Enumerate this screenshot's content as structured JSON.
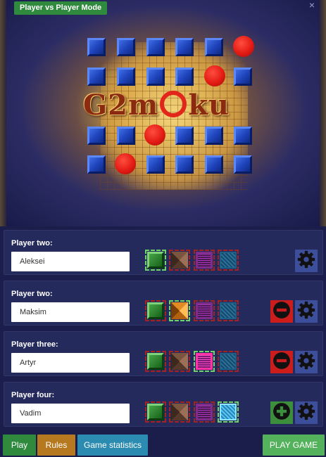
{
  "mode_badge": "Player vs Player Mode",
  "close_symbol": "×",
  "logo": {
    "part1": "G",
    "part2": "2m",
    "part3": "ku"
  },
  "players": [
    {
      "label": "Player two:",
      "name": "Aleksei",
      "selected_tile": "green",
      "action": "none"
    },
    {
      "label": "Player two:",
      "name": "Maksim",
      "selected_tile": "orange",
      "action": "remove"
    },
    {
      "label": "Player three:",
      "name": "Artyr",
      "selected_tile": "purple",
      "action": "remove"
    },
    {
      "label": "Player four:",
      "name": "Vadim",
      "selected_tile": "blue",
      "action": "add"
    }
  ],
  "tile_options": [
    "green",
    "brown",
    "purple",
    "blue"
  ],
  "icons": {
    "remove": "minus-circle-icon",
    "add": "plus-circle-icon",
    "settings": "gear-icon",
    "close": "close-icon"
  },
  "bottom": {
    "play": "Play",
    "rules": "Rules",
    "stats": "Game statistics",
    "play_game": "PLAY GAME"
  },
  "colors": {
    "background": "#1b1d4a",
    "panel": "#252a5c",
    "play_button": "#2f8a3e",
    "rules_button": "#b7791f",
    "stats_button": "#2b8bb0",
    "play_game_button": "#55b25c",
    "remove_button": "#cc1d1d",
    "add_button": "#3d8e3c",
    "settings_button": "#3d4f9b"
  }
}
